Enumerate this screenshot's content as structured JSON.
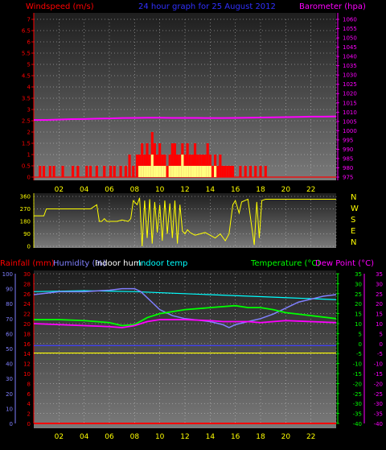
{
  "chart_data": [
    {
      "type": "bar",
      "title": "24 hour graph for  25 August 2012",
      "ylabel_left": "Windspeed (m/s)",
      "ylabel_right": "Barometer (hpa)",
      "colors": {
        "gust": "#ff0000",
        "average": "#ffff80",
        "barometer": "#ff00ff",
        "title": "#3030ff"
      },
      "ylim_left": [
        0,
        7
      ],
      "yticks_left": [
        "0",
        "0.5",
        "1",
        "1.5",
        "2",
        "2.5",
        "3",
        "3.5",
        "4",
        "4.5",
        "5",
        "5.5",
        "6",
        "6.5",
        "7"
      ],
      "ylim_right": [
        975,
        1060
      ],
      "yticks_right": [
        "975",
        "980",
        "985",
        "990",
        "995",
        "1000",
        "1005",
        "1010",
        "1015",
        "1020",
        "1025",
        "1030",
        "1035",
        "1040",
        "1045",
        "1050",
        "1055",
        "1060"
      ],
      "xticks": [
        "02",
        "04",
        "06",
        "08",
        "10",
        "12",
        "14",
        "16",
        "18",
        "20",
        "22"
      ],
      "xlim": [
        0,
        24
      ],
      "barometer_hpa": [
        1005.8,
        1005.8,
        1006.0,
        1006.2,
        1006.3,
        1006.5,
        1006.6,
        1006.8,
        1006.9,
        1007.0,
        1007.0,
        1006.9,
        1006.9,
        1006.9,
        1006.8,
        1006.8,
        1006.9,
        1007.0,
        1007.1,
        1007.2,
        1007.3,
        1007.4,
        1007.6,
        1007.6,
        1007.7
      ],
      "wind_gust_ms": [
        [
          0.5,
          0.5
        ],
        [
          0.8,
          0.5
        ],
        [
          1.3,
          0.5
        ],
        [
          1.6,
          0.5
        ],
        [
          2.3,
          0.5
        ],
        [
          3.1,
          0.5
        ],
        [
          3.5,
          0.5
        ],
        [
          4.2,
          0.5
        ],
        [
          4.5,
          0.5
        ],
        [
          5.0,
          0.5
        ],
        [
          5.6,
          0.5
        ],
        [
          6.1,
          0.5
        ],
        [
          6.4,
          0.5
        ],
        [
          6.9,
          0.5
        ],
        [
          7.3,
          0.5
        ],
        [
          7.6,
          1.0
        ],
        [
          7.9,
          0.5
        ],
        [
          8.2,
          1.0
        ],
        [
          8.4,
          1.0
        ],
        [
          8.6,
          1.5
        ],
        [
          8.8,
          1.0
        ],
        [
          9.0,
          1.5
        ],
        [
          9.2,
          1.0
        ],
        [
          9.4,
          2.0
        ],
        [
          9.6,
          1.5
        ],
        [
          9.8,
          1.0
        ],
        [
          10.0,
          1.5
        ],
        [
          10.2,
          1.0
        ],
        [
          10.4,
          1.0
        ],
        [
          10.6,
          0.5
        ],
        [
          10.8,
          1.0
        ],
        [
          11.0,
          1.5
        ],
        [
          11.2,
          1.5
        ],
        [
          11.4,
          1.0
        ],
        [
          11.6,
          1.0
        ],
        [
          11.8,
          1.5
        ],
        [
          12.0,
          1.0
        ],
        [
          12.2,
          1.5
        ],
        [
          12.4,
          1.0
        ],
        [
          12.6,
          1.0
        ],
        [
          12.8,
          1.5
        ],
        [
          13.0,
          1.0
        ],
        [
          13.2,
          1.0
        ],
        [
          13.4,
          1.0
        ],
        [
          13.6,
          1.0
        ],
        [
          13.8,
          1.5
        ],
        [
          14.0,
          1.0
        ],
        [
          14.2,
          0.5
        ],
        [
          14.4,
          1.0
        ],
        [
          14.6,
          0.5
        ],
        [
          14.8,
          1.0
        ],
        [
          15.0,
          0.5
        ],
        [
          15.2,
          0.5
        ],
        [
          15.4,
          0.5
        ],
        [
          15.6,
          0.5
        ],
        [
          15.8,
          0.5
        ],
        [
          16.4,
          0.5
        ],
        [
          16.8,
          0.5
        ],
        [
          17.2,
          0.5
        ],
        [
          17.6,
          0.5
        ],
        [
          18.0,
          0.5
        ],
        [
          18.4,
          0.5
        ]
      ],
      "wind_avg_ms": [
        [
          8.4,
          0.5
        ],
        [
          8.6,
          0.5
        ],
        [
          8.8,
          0.5
        ],
        [
          9.0,
          0.5
        ],
        [
          9.2,
          0.5
        ],
        [
          9.4,
          1.0
        ],
        [
          9.6,
          0.5
        ],
        [
          9.8,
          0.5
        ],
        [
          10.0,
          0.5
        ],
        [
          10.2,
          0.5
        ],
        [
          10.4,
          0.5
        ],
        [
          10.8,
          0.5
        ],
        [
          11.0,
          0.5
        ],
        [
          11.2,
          0.5
        ],
        [
          11.4,
          0.5
        ],
        [
          11.6,
          0.5
        ],
        [
          11.8,
          1.0
        ],
        [
          12.0,
          0.5
        ],
        [
          12.2,
          0.5
        ],
        [
          12.4,
          0.5
        ],
        [
          12.6,
          0.5
        ],
        [
          12.8,
          0.5
        ],
        [
          13.0,
          0.5
        ],
        [
          13.2,
          0.5
        ],
        [
          13.4,
          0.5
        ],
        [
          13.6,
          0.5
        ],
        [
          13.8,
          0.5
        ],
        [
          14.0,
          0.5
        ],
        [
          14.4,
          0.5
        ]
      ]
    },
    {
      "type": "line",
      "ylabel": "Wind direction",
      "ylim": [
        0,
        360
      ],
      "yticks": [
        "0",
        "90",
        "180",
        "270",
        "360"
      ],
      "direction_labels": [
        "N",
        "W",
        "S",
        "E",
        "N"
      ],
      "colors": {
        "direction": "#ffff00",
        "labels": "#ffff00"
      },
      "xlim": [
        0,
        24
      ],
      "direction_deg": [
        [
          0,
          220
        ],
        [
          0.8,
          220
        ],
        [
          1.0,
          270
        ],
        [
          3.0,
          270
        ],
        [
          4.5,
          270
        ],
        [
          5.0,
          300
        ],
        [
          5.2,
          180
        ],
        [
          5.4,
          180
        ],
        [
          5.6,
          200
        ],
        [
          5.8,
          180
        ],
        [
          6.2,
          180
        ],
        [
          6.6,
          180
        ],
        [
          7.0,
          190
        ],
        [
          7.5,
          180
        ],
        [
          7.7,
          200
        ],
        [
          7.9,
          330
        ],
        [
          8.2,
          300
        ],
        [
          8.4,
          350
        ],
        [
          8.6,
          0
        ],
        [
          8.8,
          330
        ],
        [
          9.0,
          60
        ],
        [
          9.2,
          340
        ],
        [
          9.4,
          20
        ],
        [
          9.6,
          320
        ],
        [
          9.8,
          100
        ],
        [
          10.0,
          300
        ],
        [
          10.2,
          40
        ],
        [
          10.4,
          330
        ],
        [
          10.6,
          90
        ],
        [
          10.8,
          310
        ],
        [
          11.0,
          60
        ],
        [
          11.2,
          330
        ],
        [
          11.4,
          20
        ],
        [
          11.6,
          300
        ],
        [
          11.8,
          110
        ],
        [
          12.0,
          90
        ],
        [
          12.2,
          120
        ],
        [
          12.4,
          100
        ],
        [
          12.8,
          80
        ],
        [
          13.2,
          90
        ],
        [
          13.6,
          100
        ],
        [
          14.0,
          80
        ],
        [
          14.4,
          60
        ],
        [
          14.8,
          90
        ],
        [
          15.2,
          40
        ],
        [
          15.5,
          90
        ],
        [
          15.8,
          300
        ],
        [
          16.0,
          330
        ],
        [
          16.3,
          240
        ],
        [
          16.5,
          320
        ],
        [
          17.0,
          340
        ],
        [
          17.5,
          10
        ],
        [
          17.7,
          320
        ],
        [
          17.9,
          60
        ],
        [
          18.1,
          330
        ],
        [
          18.4,
          340
        ],
        [
          19.0,
          340
        ],
        [
          20.0,
          340
        ],
        [
          22.0,
          340
        ],
        [
          24.0,
          340
        ]
      ]
    },
    {
      "type": "line",
      "labels": [
        "Rainfall (mm)",
        "Humidity (%)",
        "Indoor hum",
        "Indoor temp",
        "Temperature (°C)",
        "Dew Point (°C)"
      ],
      "colors": {
        "rainfall": "#ff0000",
        "humidity": "#8080ff",
        "indoor_hum": "#ffffff",
        "indoor_temp": "#00ffff",
        "temperature": "#00ff00",
        "dew_point": "#ff00ff",
        "pressure_line": "#4040ff",
        "yellow_line": "#ffff00"
      },
      "yticks_humidity": [
        "0",
        "10",
        "20",
        "30",
        "40",
        "50",
        "60",
        "70",
        "80",
        "90",
        "100"
      ],
      "yticks_rain": [
        "0",
        "2",
        "4",
        "6",
        "8",
        "10",
        "12",
        "14",
        "16",
        "18",
        "20",
        "22",
        "24",
        "26",
        "28",
        "30"
      ],
      "yticks_temp": [
        "35",
        "30",
        "25",
        "20",
        "15",
        "10",
        "5",
        "0",
        "-5",
        "-10",
        "-15",
        "-20",
        "-25",
        "-30",
        "-35",
        "-40"
      ],
      "yticks_dew": [
        "35",
        "30",
        "25",
        "20",
        "15",
        "10",
        "5",
        "0",
        "-5",
        "-10",
        "-15",
        "-20",
        "-25",
        "-30",
        "-35",
        "-40"
      ],
      "xticks": [
        "02",
        "04",
        "06",
        "08",
        "10",
        "12",
        "14",
        "16",
        "18",
        "20",
        "22"
      ],
      "xlim": [
        0,
        24
      ],
      "humidity_pct": [
        [
          0,
          86
        ],
        [
          2,
          88
        ],
        [
          4,
          88
        ],
        [
          6,
          89
        ],
        [
          7,
          90
        ],
        [
          8,
          90
        ],
        [
          8.5,
          88
        ],
        [
          9,
          84
        ],
        [
          10,
          76
        ],
        [
          11,
          72
        ],
        [
          12,
          70
        ],
        [
          13,
          69
        ],
        [
          14,
          68
        ],
        [
          15,
          66
        ],
        [
          15.5,
          64
        ],
        [
          16,
          66
        ],
        [
          17,
          68
        ],
        [
          18,
          70
        ],
        [
          19,
          73
        ],
        [
          20,
          77
        ],
        [
          21,
          81
        ],
        [
          22,
          83
        ],
        [
          23,
          85
        ],
        [
          24,
          86
        ]
      ],
      "indoor_temp_c": [
        [
          0,
          26
        ],
        [
          4,
          26.5
        ],
        [
          8,
          26
        ],
        [
          12,
          25
        ],
        [
          16,
          24
        ],
        [
          20,
          23
        ],
        [
          24,
          22
        ]
      ],
      "temperature_c": [
        [
          0,
          12
        ],
        [
          2,
          12
        ],
        [
          4,
          11.5
        ],
        [
          6,
          10.5
        ],
        [
          7,
          9
        ],
        [
          8,
          9.5
        ],
        [
          9,
          13
        ],
        [
          10,
          15
        ],
        [
          12,
          17
        ],
        [
          14,
          18
        ],
        [
          16,
          19
        ],
        [
          17,
          18
        ],
        [
          18,
          18
        ],
        [
          19,
          17
        ],
        [
          20,
          15.5
        ],
        [
          22,
          14
        ],
        [
          24,
          12.5
        ]
      ],
      "dew_point_c": [
        [
          0,
          10
        ],
        [
          2,
          9.5
        ],
        [
          4,
          9
        ],
        [
          6,
          8.5
        ],
        [
          7,
          8
        ],
        [
          8,
          9
        ],
        [
          9,
          11
        ],
        [
          10,
          12
        ],
        [
          12,
          12
        ],
        [
          14,
          11.5
        ],
        [
          15,
          11
        ],
        [
          16,
          11
        ],
        [
          17,
          11
        ],
        [
          18,
          10.5
        ],
        [
          19,
          11
        ],
        [
          20,
          11.5
        ],
        [
          22,
          11
        ],
        [
          24,
          10.5
        ]
      ],
      "indoor_hum_pct": [
        [
          0,
          47
        ],
        [
          24,
          47
        ]
      ],
      "rainfall_mm": [
        [
          0,
          0
        ],
        [
          24,
          0
        ]
      ]
    }
  ]
}
